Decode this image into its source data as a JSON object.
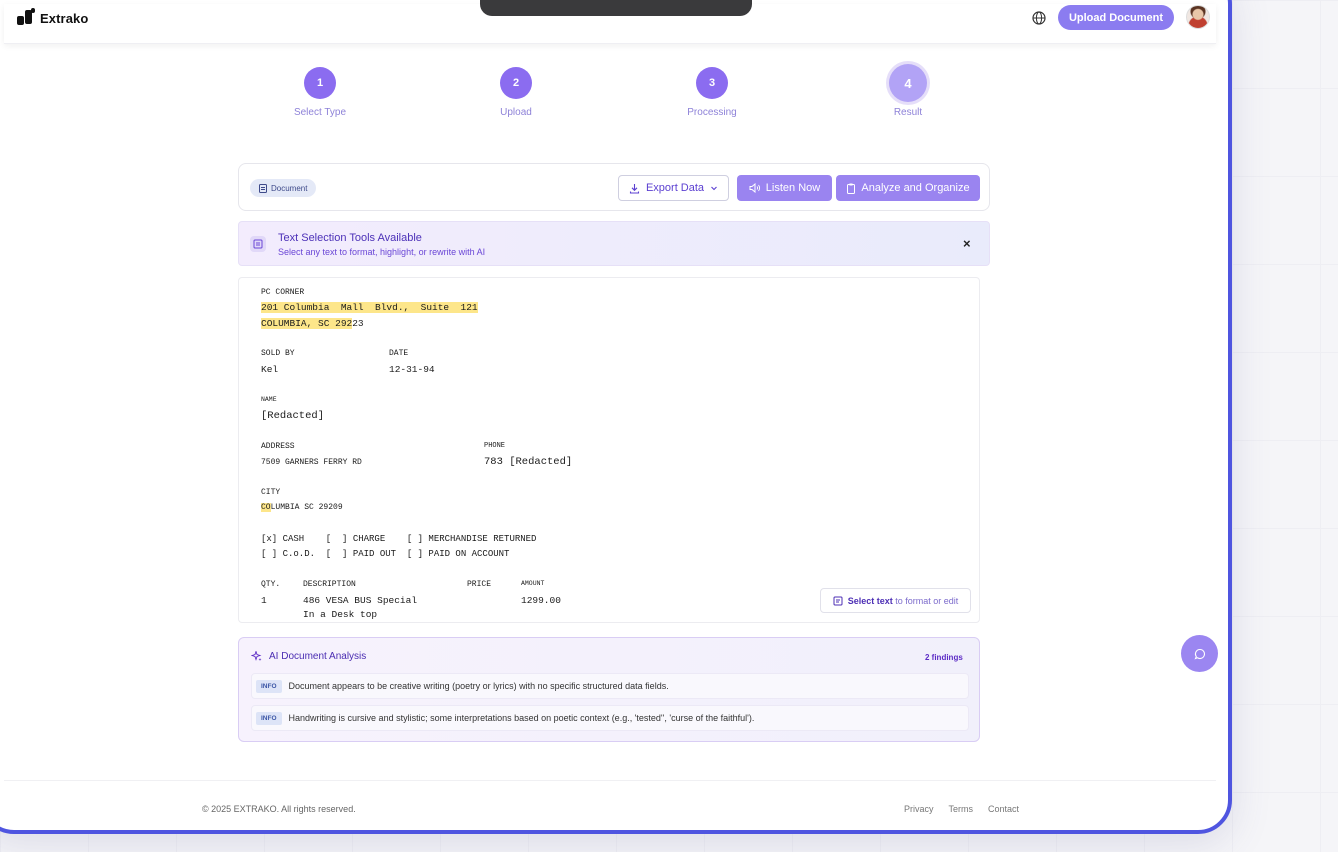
{
  "header": {
    "logo_text": "Extrako",
    "upload_button": "Upload Document"
  },
  "stepper": [
    {
      "number": "1",
      "label": "Select Type"
    },
    {
      "number": "2",
      "label": "Upload"
    },
    {
      "number": "3",
      "label": "Processing"
    },
    {
      "number": "4",
      "label": "Result"
    }
  ],
  "toolbar": {
    "doc_chip": "Document",
    "export_label": "Export Data",
    "listen_label": "Listen Now",
    "analyze_label": "Analyze and Organize"
  },
  "banner": {
    "title": "Text Selection Tools Available",
    "subtitle": "Select any text to format, highlight, or rewrite with AI",
    "close": "×"
  },
  "document": {
    "store_name": "PC CORNER",
    "address_line1": "201 Columbia  Mall  Blvd.,  Suite  121",
    "address_line2_hl": "COLUMBIA, SC 292",
    "address_line2_rest": "23",
    "sold_by_label": "SOLD BY",
    "sold_by_value": "Kel",
    "date_label": "DATE",
    "date_value": "12-31-94",
    "name_label": "NAME",
    "name_value": "[Redacted]",
    "address_label": "ADDRESS",
    "address_value": "7509 GARNERS FERRY RD",
    "phone_label": "PHONE",
    "phone_value": "783 [Redacted]",
    "city_label": "CITY",
    "city_value_hl": "CO",
    "city_value_rest": "LUMBIA SC 29209",
    "options_line1": "[x] CASH    [  ] CHARGE    [ ] MERCHANDISE RETURNED",
    "options_line2": "[ ] C.o.D.  [  ] PAID OUT  [ ] PAID ON ACCOUNT",
    "qty_label": "QTY.",
    "desc_label": "DESCRIPTION",
    "price_label": "PRICE",
    "amount_label": "AMOUNT",
    "item_qty": "1",
    "item_desc_line1": "486 VESA BUS Special",
    "item_desc_line2": "In a Desk top",
    "item_amount": "1299.00"
  },
  "select_hint": {
    "bold": "Select text",
    "rest": " to format or edit"
  },
  "ai_analysis": {
    "title": "AI Document Analysis",
    "count": "2 findings",
    "findings": [
      {
        "tag": "INFO",
        "text": "Document appears to be creative writing (poetry or lyrics) with no specific structured data fields."
      },
      {
        "tag": "INFO",
        "text": "Handwriting is cursive and stylistic; some interpretations based on poetic context (e.g., 'tested'', 'curse of the faithful')."
      }
    ]
  },
  "footer": {
    "copyright": "© 2025 EXTRAKO. All rights reserved.",
    "links": [
      "Privacy",
      "Terms",
      "Contact"
    ]
  },
  "colors": {
    "accent": "#8b6cf0",
    "frame_border": "#4f55e0",
    "highlight": "#fde68a"
  }
}
